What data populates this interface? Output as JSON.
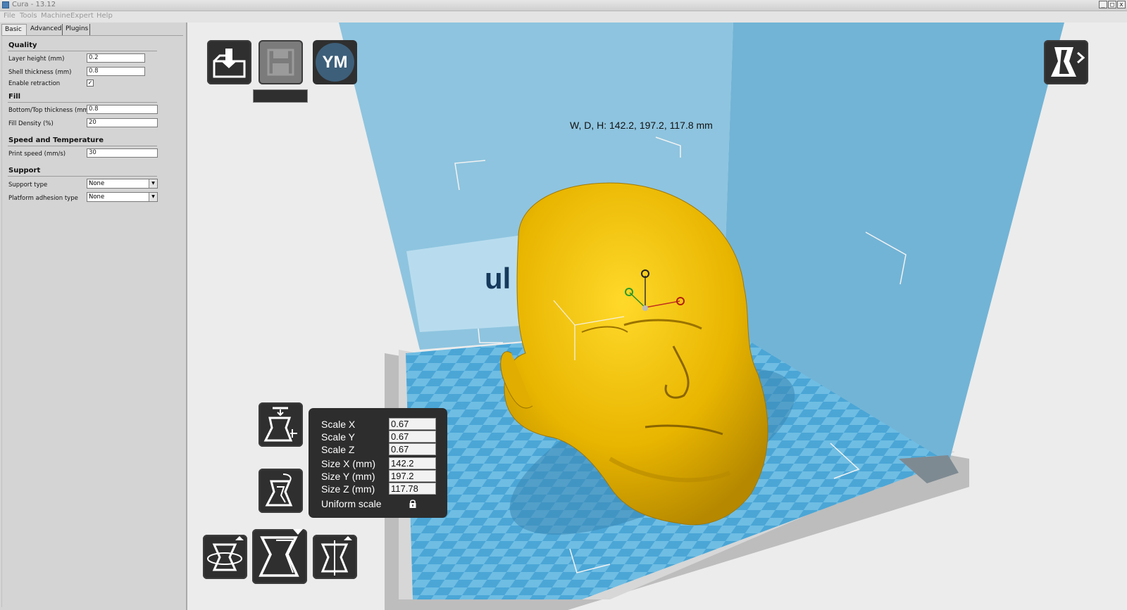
{
  "window": {
    "title": "Cura - 13.12",
    "controls": [
      "_",
      "□",
      "x"
    ]
  },
  "menu": [
    "File",
    "Tools",
    "Machine",
    "Expert",
    "Help"
  ],
  "tabs": [
    {
      "label": "Basic",
      "active": true
    },
    {
      "label": "Advanced",
      "active": false
    },
    {
      "label": "Plugins",
      "active": false
    }
  ],
  "sections": {
    "quality": {
      "title": "Quality",
      "layer_height": {
        "label": "Layer height (mm)",
        "value": "0.2"
      },
      "shell_thickness": {
        "label": "Shell thickness (mm)",
        "value": "0.8"
      },
      "retraction": {
        "label": "Enable retraction",
        "checked": "✓"
      }
    },
    "fill": {
      "title": "Fill",
      "bottom_top": {
        "label": "Bottom/Top thickness (mm)",
        "value": "0.8"
      },
      "density": {
        "label": "Fill Density (%)",
        "value": "20"
      }
    },
    "speed": {
      "title": "Speed and Temperature",
      "print_speed": {
        "label": "Print speed (mm/s)",
        "value": "30"
      }
    },
    "support": {
      "title": "Support",
      "support_type": {
        "label": "Support type",
        "value": "None"
      },
      "adhesion": {
        "label": "Platform adhesion type",
        "value": "None"
      }
    }
  },
  "viewport": {
    "ym_label": "YM",
    "dimensions": "W, D, H: 142.2, 197.2, 117.8 mm",
    "logo_fragment": "ul",
    "scale": {
      "scale_x": {
        "label": "Scale X",
        "value": "0.67"
      },
      "scale_y": {
        "label": "Scale Y",
        "value": "0.67"
      },
      "scale_z": {
        "label": "Scale Z",
        "value": "0.67"
      },
      "size_x": {
        "label": "Size X (mm)",
        "value": "142.2"
      },
      "size_y": {
        "label": "Size Y (mm)",
        "value": "197.2"
      },
      "size_z": {
        "label": "Size Z (mm)",
        "value": "117.78"
      },
      "uniform": {
        "label": "Uniform scale"
      }
    }
  },
  "colors": {
    "model": "#f2c200",
    "platform": "#4aa8d8",
    "walls": "#9fcfe6",
    "toolbar_button": "#2f2f2f"
  }
}
